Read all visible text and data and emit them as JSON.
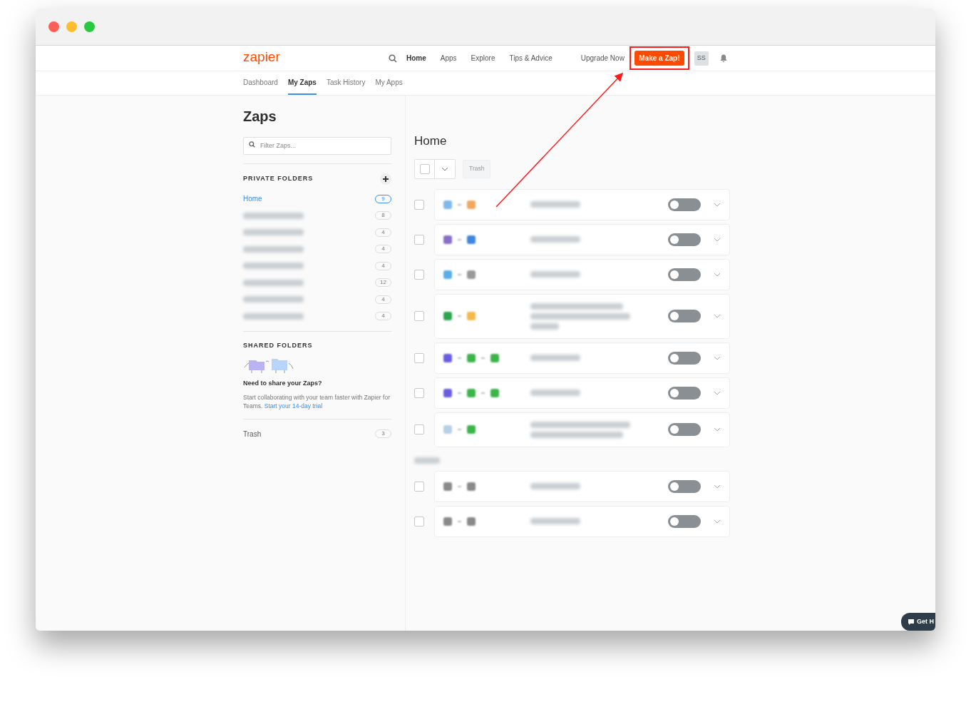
{
  "nav": {
    "logo": "zapier",
    "links": [
      {
        "label": "Home",
        "selected": true
      },
      {
        "label": "Apps",
        "selected": false
      },
      {
        "label": "Explore",
        "selected": false
      },
      {
        "label": "Tips & Advice",
        "selected": false
      }
    ],
    "upgrade": "Upgrade Now",
    "cta": "Make a Zap!",
    "avatar": "SS"
  },
  "tabs": [
    {
      "label": "Dashboard",
      "selected": false
    },
    {
      "label": "My Zaps",
      "selected": true
    },
    {
      "label": "Task History",
      "selected": false
    },
    {
      "label": "My Apps",
      "selected": false
    }
  ],
  "sidebar": {
    "title": "Zaps",
    "filter": {
      "placeholder": "Filter Zaps..."
    },
    "private_heading": "PRIVATE FOLDERS",
    "folders": [
      {
        "name": "Home",
        "count": "9",
        "selected": true
      },
      {
        "count": "8",
        "selected": false
      },
      {
        "count": "4",
        "selected": false
      },
      {
        "count": "4",
        "selected": false
      },
      {
        "count": "4",
        "selected": false
      },
      {
        "count": "12",
        "selected": false
      },
      {
        "count": "4",
        "selected": false
      },
      {
        "count": "4",
        "selected": false
      }
    ],
    "shared_heading": "SHARED FOLDERS",
    "share_title": "Need to share your Zaps?",
    "share_text": "Start collaborating with your team faster with Zapier for Teams.",
    "share_link": "Start your 14-day trial",
    "trash": {
      "label": "Trash",
      "count": "3"
    }
  },
  "main": {
    "title": "Home",
    "select_all": {
      "checked": false
    },
    "trash_button": "Trash",
    "zaps": [
      {
        "kind": "short",
        "checked": false,
        "on": false,
        "apps": [
          {
            "color": "#7fb8ea"
          },
          {
            "color": "#f0a860"
          }
        ]
      },
      {
        "kind": "short",
        "checked": false,
        "on": false,
        "apps": [
          {
            "color": "#8a6fc8"
          },
          {
            "color": "#3f86dc"
          }
        ]
      },
      {
        "kind": "short",
        "checked": false,
        "on": false,
        "apps": [
          {
            "color": "#5aaee8"
          },
          {
            "color": "#9a9a9a"
          }
        ]
      },
      {
        "kind": "long",
        "checked": false,
        "on": false,
        "apps": [
          {
            "color": "#2da44e"
          },
          {
            "color": "#f5b84a"
          }
        ]
      },
      {
        "kind": "short",
        "checked": false,
        "on": false,
        "apps": [
          {
            "color": "#6a5ee0"
          },
          {
            "color": "#3bb54a"
          },
          {
            "color": "#3bb54a"
          }
        ]
      },
      {
        "kind": "short",
        "checked": false,
        "on": false,
        "apps": [
          {
            "color": "#6a5ee0"
          },
          {
            "color": "#3bb54a"
          },
          {
            "color": "#3bb54a"
          }
        ]
      },
      {
        "kind": "medium",
        "checked": false,
        "on": false,
        "apps": [
          {
            "color": "#b8cfe8"
          },
          {
            "color": "#3bb54a"
          }
        ]
      }
    ],
    "drafts": [
      {
        "kind": "short",
        "checked": false,
        "on": false,
        "apps": [
          {
            "color": "#8a8a8a"
          },
          {
            "color": "#8a8a8a"
          }
        ]
      },
      {
        "kind": "short",
        "checked": false,
        "on": false,
        "apps": [
          {
            "color": "#8a8a8a"
          },
          {
            "color": "#8a8a8a"
          }
        ]
      }
    ]
  },
  "help": "Get H"
}
